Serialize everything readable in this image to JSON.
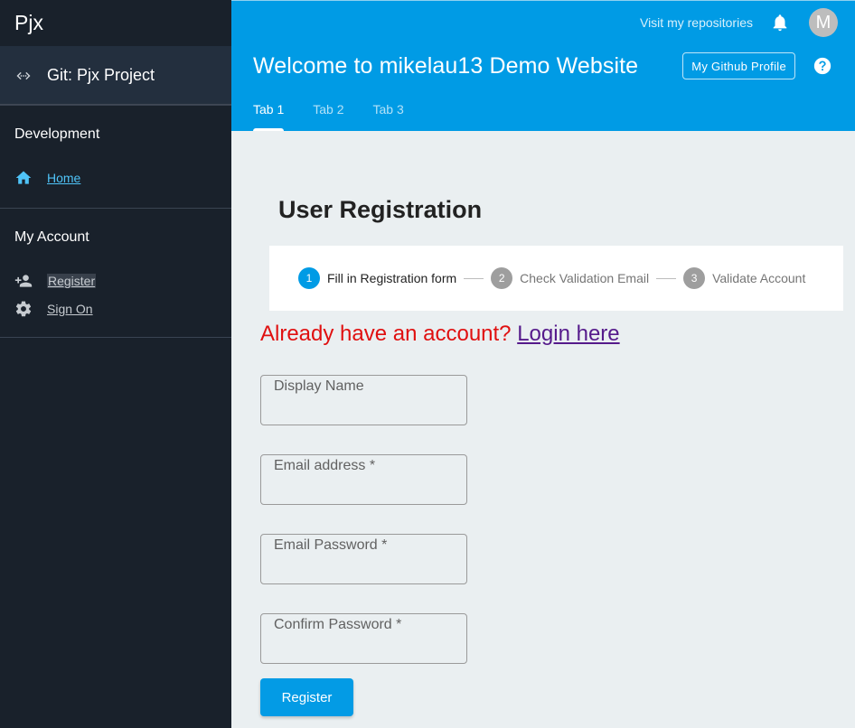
{
  "sidebar": {
    "brand": "Pjx",
    "project": {
      "label": "Git: Pjx Project",
      "icon": "code-icon"
    },
    "sections": [
      {
        "title": "Development",
        "items": [
          {
            "label": "Home",
            "icon": "home-icon"
          }
        ]
      },
      {
        "title": "My Account",
        "items": [
          {
            "label": "Register",
            "icon": "person-add-icon"
          },
          {
            "label": "Sign On",
            "icon": "gear-icon"
          }
        ]
      }
    ]
  },
  "header": {
    "top_link": "Visit my repositories",
    "avatar_letter": "M",
    "title": "Welcome to mikelau13 Demo Website",
    "github_button": "My Github Profile",
    "tabs": [
      "Tab 1",
      "Tab 2",
      "Tab 3"
    ],
    "accent_color": "#009be5"
  },
  "main": {
    "heading": "User Registration",
    "steps": [
      {
        "num": "1",
        "label": "Fill in Registration form"
      },
      {
        "num": "2",
        "label": "Check Validation Email"
      },
      {
        "num": "3",
        "label": "Validate Account"
      }
    ],
    "already_text": "Already have an account?",
    "login_link": "Login here",
    "fields": [
      {
        "label": "Display Name"
      },
      {
        "label": "Email address *"
      },
      {
        "label": "Email Password *"
      },
      {
        "label": "Confirm Password *"
      }
    ],
    "register_button": "Register"
  }
}
